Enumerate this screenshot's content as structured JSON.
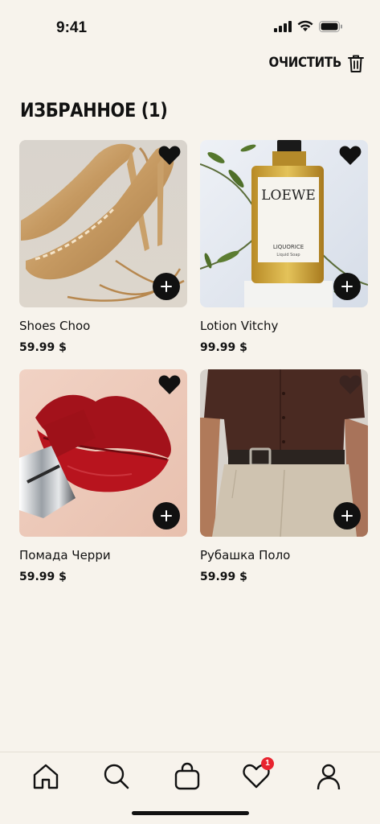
{
  "status_bar": {
    "time": "9:41"
  },
  "header": {
    "clear_label": "ОЧИСТИТЬ"
  },
  "page": {
    "title": "ИЗБРАННОЕ (1)"
  },
  "products": [
    {
      "name": "Shoes Choo",
      "price": "59.99 $",
      "image": "gold-heeled-sandals"
    },
    {
      "name": "Lotion Vitchy",
      "price": "99.99 $",
      "image": "loewe-liquid-soap-bottle",
      "bottle_brand": "LOEWE",
      "bottle_product": "LIQUORICE",
      "bottle_subtitle": "Liquid Soap"
    },
    {
      "name": "Помада Черри",
      "price": "59.99 $",
      "image": "red-lips-with-lipstick"
    },
    {
      "name": "Рубашка Поло",
      "price": "59.99 $",
      "image": "brown-polo-shirt-outfit"
    }
  ],
  "tabbar": {
    "items": [
      "home-icon",
      "search-icon",
      "bag-icon",
      "heart-icon",
      "profile-icon"
    ],
    "favorites_badge": "1",
    "badge_color": "#e8232e"
  },
  "colors": {
    "background": "#f7f3ec",
    "text": "#111111"
  }
}
